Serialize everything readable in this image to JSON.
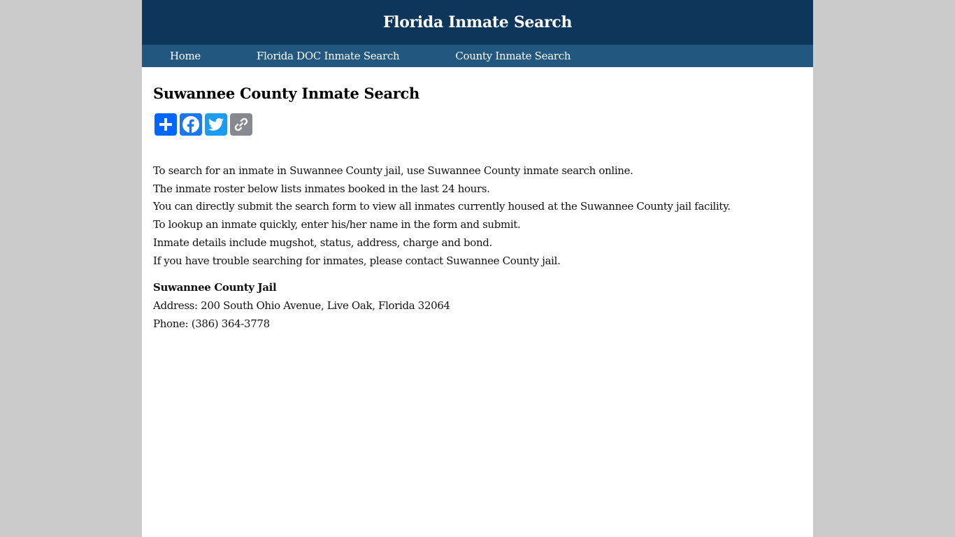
{
  "header": {
    "site_title": "Florida Inmate Search"
  },
  "nav": {
    "items": [
      {
        "label": "Home"
      },
      {
        "label": "Florida DOC Inmate Search"
      },
      {
        "label": "County Inmate Search"
      }
    ]
  },
  "main": {
    "title": "Suwannee County Inmate Search",
    "share_buttons": [
      {
        "name": "share",
        "icon": "plus-icon",
        "color": "#0166ff"
      },
      {
        "name": "facebook",
        "icon": "facebook-icon",
        "color": "#1877f2"
      },
      {
        "name": "twitter",
        "icon": "twitter-icon",
        "color": "#1d9bf0"
      },
      {
        "name": "copy-link",
        "icon": "link-icon",
        "color": "#888990"
      }
    ],
    "intro_lines": [
      "To search for an inmate in Suwannee County jail, use Suwannee County inmate search online.",
      "The inmate roster below lists inmates booked in the last 24 hours.",
      "You can directly submit the search form to view all inmates currently housed at the Suwannee County jail facility.",
      "To lookup an inmate quickly, enter his/her name in the form and submit.",
      "Inmate details include mugshot, status, address, charge and bond.",
      "If you have trouble searching for inmates, please contact Suwannee County jail."
    ],
    "jail": {
      "name": "Suwannee County Jail",
      "address": "Address: 200 South Ohio Avenue, Live Oak, Florida 32064",
      "phone": "Phone: (386) 364-3778"
    }
  },
  "colors": {
    "masthead": "#0c365a",
    "navbar": "#22577f",
    "background": "#cbcbcb"
  }
}
